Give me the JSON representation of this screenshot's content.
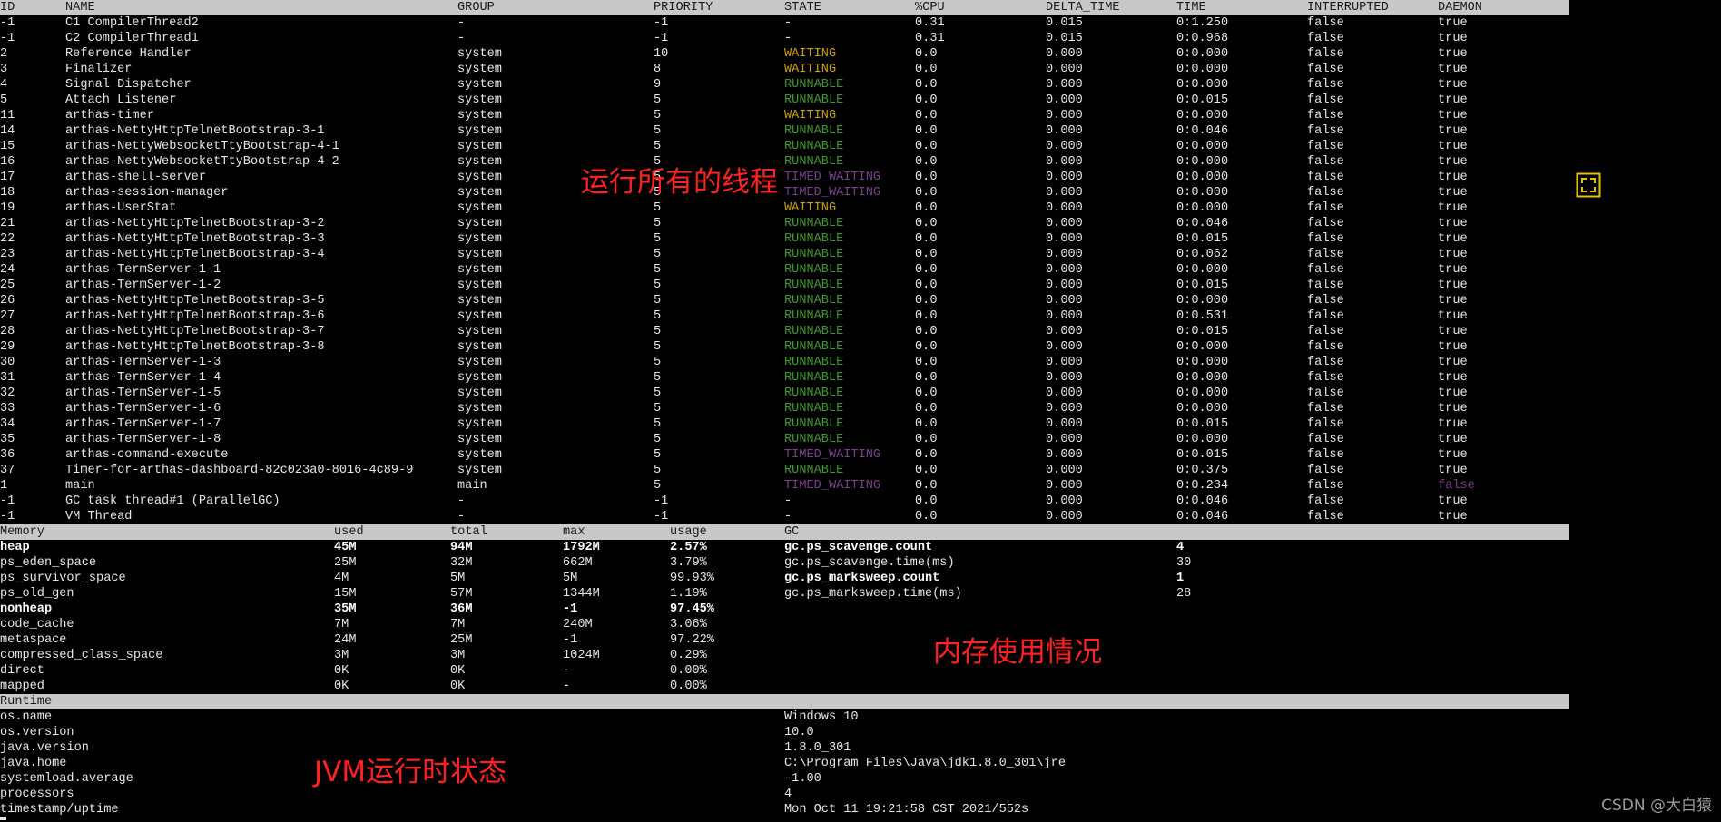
{
  "threads": {
    "headers": [
      "ID",
      "NAME",
      "GROUP",
      "PRIORITY",
      "STATE",
      "%CPU",
      "DELTA_TIME",
      "TIME",
      "INTERRUPTED",
      "DAEMON"
    ],
    "rows": [
      [
        "-1",
        "C1 CompilerThread2",
        "-",
        "-1",
        "-",
        "0.31",
        "0.015",
        "0:1.250",
        "false",
        "true"
      ],
      [
        "-1",
        "C2 CompilerThread1",
        "-",
        "-1",
        "-",
        "0.31",
        "0.015",
        "0:0.968",
        "false",
        "true"
      ],
      [
        "2",
        "Reference Handler",
        "system",
        "10",
        "WAITING",
        "0.0",
        "0.000",
        "0:0.000",
        "false",
        "true"
      ],
      [
        "3",
        "Finalizer",
        "system",
        "8",
        "WAITING",
        "0.0",
        "0.000",
        "0:0.000",
        "false",
        "true"
      ],
      [
        "4",
        "Signal Dispatcher",
        "system",
        "9",
        "RUNNABLE",
        "0.0",
        "0.000",
        "0:0.000",
        "false",
        "true"
      ],
      [
        "5",
        "Attach Listener",
        "system",
        "5",
        "RUNNABLE",
        "0.0",
        "0.000",
        "0:0.015",
        "false",
        "true"
      ],
      [
        "11",
        "arthas-timer",
        "system",
        "5",
        "WAITING",
        "0.0",
        "0.000",
        "0:0.000",
        "false",
        "true"
      ],
      [
        "14",
        "arthas-NettyHttpTelnetBootstrap-3-1",
        "system",
        "5",
        "RUNNABLE",
        "0.0",
        "0.000",
        "0:0.046",
        "false",
        "true"
      ],
      [
        "15",
        "arthas-NettyWebsocketTtyBootstrap-4-1",
        "system",
        "5",
        "RUNNABLE",
        "0.0",
        "0.000",
        "0:0.000",
        "false",
        "true"
      ],
      [
        "16",
        "arthas-NettyWebsocketTtyBootstrap-4-2",
        "system",
        "5",
        "RUNNABLE",
        "0.0",
        "0.000",
        "0:0.000",
        "false",
        "true"
      ],
      [
        "17",
        "arthas-shell-server",
        "system",
        "5",
        "TIMED_WAITING",
        "0.0",
        "0.000",
        "0:0.000",
        "false",
        "true"
      ],
      [
        "18",
        "arthas-session-manager",
        "system",
        "5",
        "TIMED_WAITING",
        "0.0",
        "0.000",
        "0:0.000",
        "false",
        "true"
      ],
      [
        "19",
        "arthas-UserStat",
        "system",
        "5",
        "WAITING",
        "0.0",
        "0.000",
        "0:0.000",
        "false",
        "true"
      ],
      [
        "21",
        "arthas-NettyHttpTelnetBootstrap-3-2",
        "system",
        "5",
        "RUNNABLE",
        "0.0",
        "0.000",
        "0:0.046",
        "false",
        "true"
      ],
      [
        "22",
        "arthas-NettyHttpTelnetBootstrap-3-3",
        "system",
        "5",
        "RUNNABLE",
        "0.0",
        "0.000",
        "0:0.015",
        "false",
        "true"
      ],
      [
        "23",
        "arthas-NettyHttpTelnetBootstrap-3-4",
        "system",
        "5",
        "RUNNABLE",
        "0.0",
        "0.000",
        "0:0.062",
        "false",
        "true"
      ],
      [
        "24",
        "arthas-TermServer-1-1",
        "system",
        "5",
        "RUNNABLE",
        "0.0",
        "0.000",
        "0:0.000",
        "false",
        "true"
      ],
      [
        "25",
        "arthas-TermServer-1-2",
        "system",
        "5",
        "RUNNABLE",
        "0.0",
        "0.000",
        "0:0.015",
        "false",
        "true"
      ],
      [
        "26",
        "arthas-NettyHttpTelnetBootstrap-3-5",
        "system",
        "5",
        "RUNNABLE",
        "0.0",
        "0.000",
        "0:0.000",
        "false",
        "true"
      ],
      [
        "27",
        "arthas-NettyHttpTelnetBootstrap-3-6",
        "system",
        "5",
        "RUNNABLE",
        "0.0",
        "0.000",
        "0:0.531",
        "false",
        "true"
      ],
      [
        "28",
        "arthas-NettyHttpTelnetBootstrap-3-7",
        "system",
        "5",
        "RUNNABLE",
        "0.0",
        "0.000",
        "0:0.015",
        "false",
        "true"
      ],
      [
        "29",
        "arthas-NettyHttpTelnetBootstrap-3-8",
        "system",
        "5",
        "RUNNABLE",
        "0.0",
        "0.000",
        "0:0.000",
        "false",
        "true"
      ],
      [
        "30",
        "arthas-TermServer-1-3",
        "system",
        "5",
        "RUNNABLE",
        "0.0",
        "0.000",
        "0:0.000",
        "false",
        "true"
      ],
      [
        "31",
        "arthas-TermServer-1-4",
        "system",
        "5",
        "RUNNABLE",
        "0.0",
        "0.000",
        "0:0.000",
        "false",
        "true"
      ],
      [
        "32",
        "arthas-TermServer-1-5",
        "system",
        "5",
        "RUNNABLE",
        "0.0",
        "0.000",
        "0:0.000",
        "false",
        "true"
      ],
      [
        "33",
        "arthas-TermServer-1-6",
        "system",
        "5",
        "RUNNABLE",
        "0.0",
        "0.000",
        "0:0.000",
        "false",
        "true"
      ],
      [
        "34",
        "arthas-TermServer-1-7",
        "system",
        "5",
        "RUNNABLE",
        "0.0",
        "0.000",
        "0:0.015",
        "false",
        "true"
      ],
      [
        "35",
        "arthas-TermServer-1-8",
        "system",
        "5",
        "RUNNABLE",
        "0.0",
        "0.000",
        "0:0.000",
        "false",
        "true"
      ],
      [
        "36",
        "arthas-command-execute",
        "system",
        "5",
        "TIMED_WAITING",
        "0.0",
        "0.000",
        "0:0.015",
        "false",
        "true"
      ],
      [
        "37",
        "Timer-for-arthas-dashboard-82c023a0-8016-4c89-9",
        "system",
        "5",
        "RUNNABLE",
        "0.0",
        "0.000",
        "0:0.375",
        "false",
        "true"
      ],
      [
        "1",
        "main",
        "main",
        "5",
        "TIMED_WAITING",
        "0.0",
        "0.000",
        "0:0.234",
        "false",
        "false"
      ],
      [
        "-1",
        "GC task thread#1 (ParallelGC)",
        "-",
        "-1",
        "-",
        "0.0",
        "0.000",
        "0:0.046",
        "false",
        "true"
      ],
      [
        "-1",
        "VM Thread",
        "-",
        "-1",
        "-",
        "0.0",
        "0.000",
        "0:0.046",
        "false",
        "true"
      ]
    ]
  },
  "memory": {
    "headers": [
      "Memory",
      "used",
      "total",
      "max",
      "usage",
      "GC"
    ],
    "rows": [
      {
        "cells": [
          "heap",
          "45M",
          "94M",
          "1792M",
          "2.57%"
        ],
        "bold": true
      },
      {
        "cells": [
          "ps_eden_space",
          "25M",
          "32M",
          "662M",
          "3.79%"
        ],
        "bold": false
      },
      {
        "cells": [
          "ps_survivor_space",
          "4M",
          "5M",
          "5M",
          "99.93%"
        ],
        "bold": false
      },
      {
        "cells": [
          "ps_old_gen",
          "15M",
          "57M",
          "1344M",
          "1.19%"
        ],
        "bold": false
      },
      {
        "cells": [
          "nonheap",
          "35M",
          "36M",
          "-1",
          "97.45%"
        ],
        "bold": true
      },
      {
        "cells": [
          "code_cache",
          "7M",
          "7M",
          "240M",
          "3.06%"
        ],
        "bold": false
      },
      {
        "cells": [
          "metaspace",
          "24M",
          "25M",
          "-1",
          "97.22%"
        ],
        "bold": false
      },
      {
        "cells": [
          "compressed_class_space",
          "3M",
          "3M",
          "1024M",
          "0.29%"
        ],
        "bold": false
      },
      {
        "cells": [
          "direct",
          "0K",
          "0K",
          "-",
          "0.00%"
        ],
        "bold": false
      },
      {
        "cells": [
          "mapped",
          "0K",
          "0K",
          "-",
          "0.00%"
        ],
        "bold": false
      }
    ],
    "gc": [
      {
        "name": "gc.ps_scavenge.count",
        "value": "4",
        "bold": true
      },
      {
        "name": "gc.ps_scavenge.time(ms)",
        "value": "30",
        "bold": false
      },
      {
        "name": "gc.ps_marksweep.count",
        "value": "1",
        "bold": true
      },
      {
        "name": "gc.ps_marksweep.time(ms)",
        "value": "28",
        "bold": false
      }
    ]
  },
  "runtime": {
    "header": "Runtime",
    "rows": [
      [
        "os.name",
        "Windows 10"
      ],
      [
        "os.version",
        "10.0"
      ],
      [
        "java.version",
        "1.8.0_301"
      ],
      [
        "java.home",
        "C:\\Program Files\\Java\\jdk1.8.0_301\\jre"
      ],
      [
        "systemload.average",
        "-1.00"
      ],
      [
        "processors",
        "4"
      ],
      [
        "timestamp/uptime",
        "Mon Oct 11 19:21:58 CST 2021/552s"
      ]
    ]
  },
  "annotations": {
    "threads": "运行所有的线程",
    "memory": "内存使用情况",
    "runtime": "JVM运行时状态"
  },
  "watermark": "CSDN @大白猿",
  "colors": {
    "WAITING": "#c8a000",
    "RUNNABLE": "#3c9a2a",
    "TIMED_WAITING": "#7a3f8c",
    "header_bg": "#c8c8c8",
    "annotation": "#ff2020",
    "focus_icon": "#e8c400"
  },
  "icons": {
    "focus": "fullscreen-corners-icon"
  }
}
